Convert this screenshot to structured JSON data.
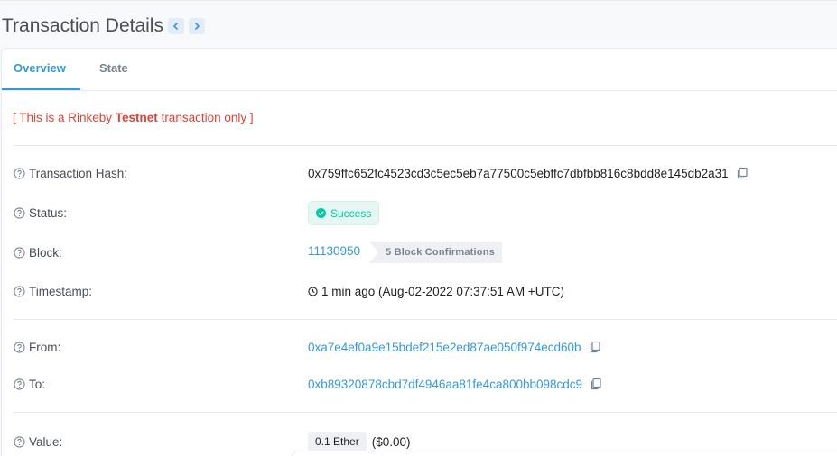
{
  "header": {
    "title": "Transaction Details",
    "prev_icon": "chevron-left-icon",
    "next_icon": "chevron-right-icon"
  },
  "tabs": [
    {
      "label": "Overview",
      "active": true
    },
    {
      "label": "State",
      "active": false
    }
  ],
  "testnet_note": {
    "prefix": "[ This is a Rinkeby ",
    "bold": "Testnet",
    "suffix": " transaction only ]"
  },
  "rows": {
    "tx_hash": {
      "label": "Transaction Hash:",
      "value": "0x759ffc652fc4523cd3c5ec5eb7a77500c5ebffc7dbfbb816c8bdd8e145db2a31"
    },
    "status": {
      "label": "Status:",
      "value": "Success"
    },
    "block": {
      "label": "Block:",
      "value": "11130950",
      "confirmations": "5 Block Confirmations"
    },
    "timestamp": {
      "label": "Timestamp:",
      "value": "1 min ago (Aug-02-2022 07:37:51 AM +UTC)"
    },
    "from": {
      "label": "From:",
      "value": "0xa7e4ef0a9e15bdef215e2ed87ae050f974ecd60b"
    },
    "to": {
      "label": "To:",
      "value": "0xb89320878cbd7df4946aa81fe4ca800bb098cdc9"
    },
    "value": {
      "label": "Value:",
      "amount": "0.1 Ether",
      "usd": "($0.00)"
    }
  },
  "colors": {
    "accent": "#3498db",
    "success": "#00c9a7",
    "warning_text": "#de4437"
  }
}
